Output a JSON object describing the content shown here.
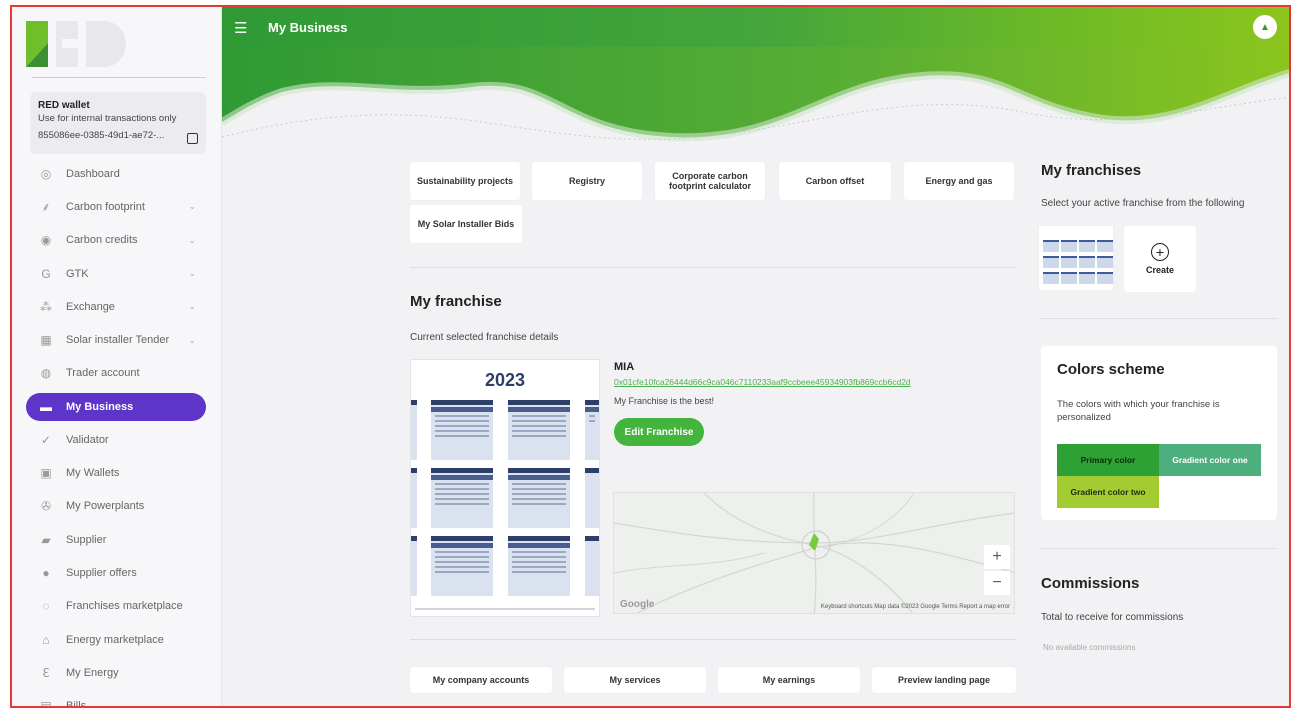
{
  "header": {
    "title": "My Business"
  },
  "sidebar": {
    "logo_text": "RED",
    "wallet": {
      "title": "RED wallet",
      "subtitle": "Use for internal transactions only",
      "id": "855086ee-0385-49d1-ae72-..."
    },
    "items": [
      {
        "label": "Dashboard",
        "icon": "dashboard-icon",
        "glyph": "◎",
        "chevron": false
      },
      {
        "label": "Carbon footprint",
        "icon": "footprint-icon",
        "glyph": "⸙",
        "chevron": true
      },
      {
        "label": "Carbon credits",
        "icon": "carbon-credits-icon",
        "glyph": "◉",
        "chevron": true
      },
      {
        "label": "GTK",
        "icon": "gtk-icon",
        "glyph": "G",
        "chevron": true
      },
      {
        "label": "Exchange",
        "icon": "exchange-icon",
        "glyph": "⁂",
        "chevron": true
      },
      {
        "label": "Solar installer Tender",
        "icon": "solar-panel-icon",
        "glyph": "▦",
        "chevron": true
      },
      {
        "label": "Trader account",
        "icon": "trader-icon",
        "glyph": "◍",
        "chevron": false
      },
      {
        "label": "My Business",
        "icon": "business-icon",
        "glyph": "▬",
        "chevron": false,
        "active": true
      },
      {
        "label": "Validator",
        "icon": "validator-icon",
        "glyph": "✓",
        "chevron": false
      },
      {
        "label": "My Wallets",
        "icon": "wallet-icon",
        "glyph": "▣",
        "chevron": false
      },
      {
        "label": "My Powerplants",
        "icon": "powerplant-icon",
        "glyph": "✇",
        "chevron": false
      },
      {
        "label": "Supplier",
        "icon": "truck-icon",
        "glyph": "▰",
        "chevron": false
      },
      {
        "label": "Supplier offers",
        "icon": "offers-icon",
        "glyph": "●",
        "chevron": false
      },
      {
        "label": "Franchises marketplace",
        "icon": "marketplace-icon",
        "glyph": "◌",
        "chevron": false
      },
      {
        "label": "Energy marketplace",
        "icon": "energy-market-icon",
        "glyph": "⌂",
        "chevron": false
      },
      {
        "label": "My Energy",
        "icon": "energy-icon",
        "glyph": "ℇ",
        "chevron": false
      },
      {
        "label": "Bills",
        "icon": "bills-icon",
        "glyph": "▤",
        "chevron": false
      }
    ]
  },
  "shortcuts": {
    "sustainability": "Sustainability projects",
    "registry": "Registry",
    "corporate": "Corporate carbon footprint calculator",
    "offset": "Carbon offset",
    "energy_gas": "Energy and gas",
    "solar_bids": "My Solar Installer Bids"
  },
  "franchise": {
    "heading": "My franchise",
    "subheading": "Current selected franchise details",
    "calendar_year": "2023",
    "name": "MIA",
    "address": "0x01cfe10fca26444d66c9ca046c7110233aaf9ccbeee45934903fb869ccb6cd2d",
    "description": "My Franchise is the best!",
    "edit_label": "Edit Franchise",
    "map_logo": "Google",
    "map_footer": "Keyboard shortcuts   Map data ©2023 Google   Terms   Report a map error"
  },
  "bottom_tabs": {
    "company_accounts": "My company accounts",
    "services": "My services",
    "earnings": "My earnings",
    "preview": "Preview landing page"
  },
  "my_franchises": {
    "heading": "My franchises",
    "subheading": "Select your active franchise from the following",
    "create_label": "Create"
  },
  "colors": {
    "heading": "Colors scheme",
    "subheading": "The colors with which your franchise is personalized",
    "primary": {
      "label": "Primary color",
      "hex": "#2ea134"
    },
    "gradient_one": {
      "label": "Gradient color one",
      "hex": "#4caf7d"
    },
    "gradient_two": {
      "label": "Gradient color two",
      "hex": "#a3cc33"
    }
  },
  "commissions": {
    "heading": "Commissions",
    "subheading": "Total to receive for commissions",
    "empty": "No available commissions"
  },
  "theme": {
    "accent": "#5d35c9",
    "green": "#43b53c"
  }
}
